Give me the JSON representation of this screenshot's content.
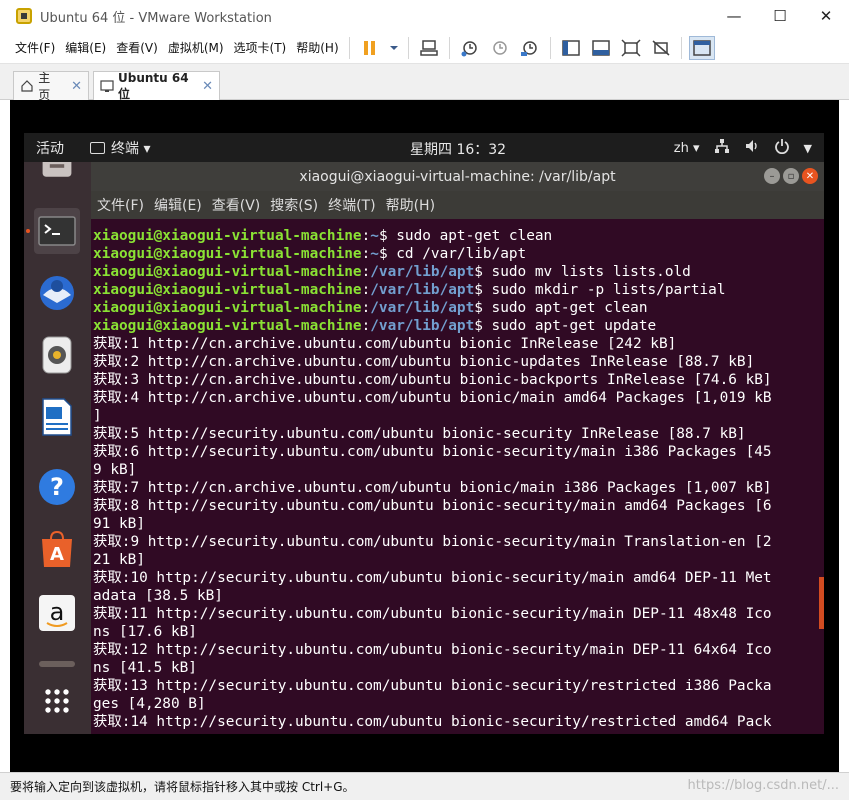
{
  "window": {
    "title": "Ubuntu 64 位 - VMware Workstation",
    "controls": {
      "minimize": "—",
      "maximize": "☐",
      "close": "✕"
    }
  },
  "menubar": {
    "items": [
      "文件(F)",
      "编辑(E)",
      "查看(V)",
      "虚拟机(M)",
      "选项卡(T)",
      "帮助(H)"
    ]
  },
  "tabs": [
    {
      "label": "主页",
      "close": "✕"
    },
    {
      "label": "Ubuntu 64 位",
      "close": "✕"
    }
  ],
  "gnome": {
    "activities": "活动",
    "app_menu": "终端 ▾",
    "clock": "星期四 16：32",
    "lang": "zh ▾"
  },
  "terminal": {
    "title": "xiaogui@xiaogui-virtual-machine: /var/lib/apt",
    "menu": [
      "文件(F)",
      "编辑(E)",
      "查看(V)",
      "搜索(S)",
      "终端(T)",
      "帮助(H)"
    ],
    "prompt_user": "xiaogui@xiaogui-virtual-machine",
    "lines": [
      {
        "user": "xiaogui@xiaogui-virtual-machine",
        "path": "~",
        "cmd": "$ sudo apt-get clean"
      },
      {
        "user": "xiaogui@xiaogui-virtual-machine",
        "path": "~",
        "cmd": "$ cd /var/lib/apt"
      },
      {
        "user": "xiaogui@xiaogui-virtual-machine",
        "path": "/var/lib/apt",
        "cmd": "$ sudo mv lists lists.old"
      },
      {
        "user": "xiaogui@xiaogui-virtual-machine",
        "path": "/var/lib/apt",
        "cmd": "$ sudo mkdir -p lists/partial"
      },
      {
        "user": "xiaogui@xiaogui-virtual-machine",
        "path": "/var/lib/apt",
        "cmd": "$ sudo apt-get clean"
      },
      {
        "user": "xiaogui@xiaogui-virtual-machine",
        "path": "/var/lib/apt",
        "cmd": "$ sudo apt-get update"
      }
    ],
    "output": [
      "获取:1 http://cn.archive.ubuntu.com/ubuntu bionic InRelease [242 kB]",
      "获取:2 http://cn.archive.ubuntu.com/ubuntu bionic-updates InRelease [88.7 kB]",
      "获取:3 http://cn.archive.ubuntu.com/ubuntu bionic-backports InRelease [74.6 kB]",
      "获取:4 http://cn.archive.ubuntu.com/ubuntu bionic/main amd64 Packages [1,019 kB",
      "]",
      "获取:5 http://security.ubuntu.com/ubuntu bionic-security InRelease [88.7 kB]",
      "获取:6 http://security.ubuntu.com/ubuntu bionic-security/main i386 Packages [45",
      "9 kB]",
      "获取:7 http://cn.archive.ubuntu.com/ubuntu bionic/main i386 Packages [1,007 kB]",
      "获取:8 http://security.ubuntu.com/ubuntu bionic-security/main amd64 Packages [6",
      "91 kB]",
      "获取:9 http://security.ubuntu.com/ubuntu bionic-security/main Translation-en [2",
      "21 kB]",
      "获取:10 http://security.ubuntu.com/ubuntu bionic-security/main amd64 DEP-11 Met",
      "adata [38.5 kB]",
      "获取:11 http://security.ubuntu.com/ubuntu bionic-security/main DEP-11 48x48 Ico",
      "ns [17.6 kB]",
      "获取:12 http://security.ubuntu.com/ubuntu bionic-security/main DEP-11 64x64 Ico",
      "ns [41.5 kB]",
      "获取:13 http://security.ubuntu.com/ubuntu bionic-security/restricted i386 Packa",
      "ges [4,280 B]",
      "获取:14 http://security.ubuntu.com/ubuntu bionic-security/restricted amd64 Pack"
    ]
  },
  "statusbar": {
    "text": "要将输入定向到该虚拟机，请将鼠标指针移入其中或按 Ctrl+G。",
    "watermark": "https://blog.csdn.net/..."
  },
  "colors": {
    "terminal_bg": "#300a24",
    "prompt_green": "#8ae234",
    "prompt_blue": "#729fcf",
    "ubuntu_orange": "#e95420"
  }
}
